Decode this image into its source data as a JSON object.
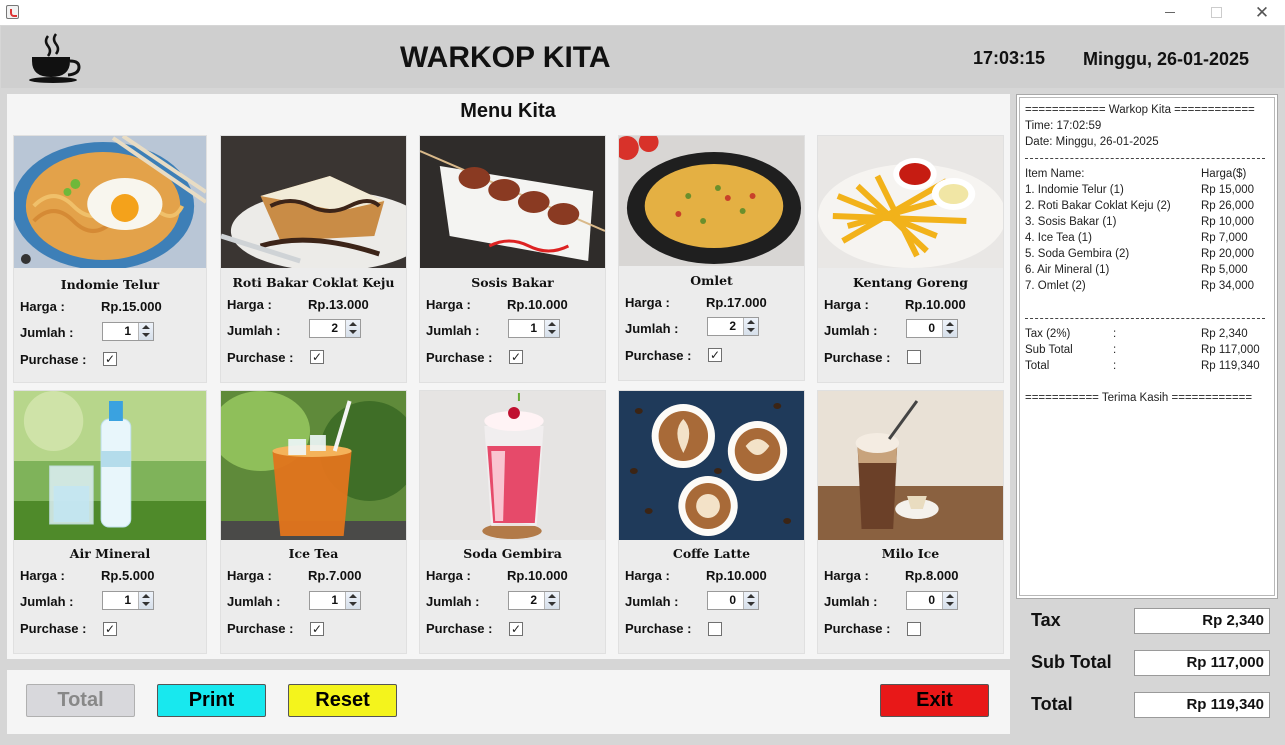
{
  "window": {
    "controls": [
      "minimize",
      "maximize",
      "close"
    ]
  },
  "header": {
    "title": "WARKOP KITA",
    "time": "17:03:15",
    "date": "Minggu, 26-01-2025",
    "logo_icon": "coffee-cup-icon"
  },
  "menu": {
    "title": "Menu Kita",
    "labels": {
      "price": "Harga :",
      "qty": "Jumlah :",
      "purchase": "Purchase :"
    },
    "items": [
      {
        "name": "Indomie Telur",
        "price": "Rp.15.000",
        "qty": "1",
        "purchased": true,
        "image": "noodle-egg-photo"
      },
      {
        "name": "Roti Bakar Coklat Keju",
        "price": "Rp.13.000",
        "qty": "2",
        "purchased": true,
        "image": "toast-photo"
      },
      {
        "name": "Sosis Bakar",
        "price": "Rp.10.000",
        "qty": "1",
        "purchased": true,
        "image": "sausage-photo"
      },
      {
        "name": "Omlet",
        "price": "Rp.17.000",
        "qty": "2",
        "purchased": true,
        "image": "omelette-photo"
      },
      {
        "name": "Kentang Goreng",
        "price": "Rp.10.000",
        "qty": "0",
        "purchased": false,
        "image": "fries-photo"
      },
      {
        "name": "Air Mineral",
        "price": "Rp.5.000",
        "qty": "1",
        "purchased": true,
        "image": "water-photo"
      },
      {
        "name": "Ice Tea",
        "price": "Rp.7.000",
        "qty": "1",
        "purchased": true,
        "image": "ice-tea-photo"
      },
      {
        "name": "Soda Gembira",
        "price": "Rp.10.000",
        "qty": "2",
        "purchased": true,
        "image": "soda-photo"
      },
      {
        "name": "Coffe Latte",
        "price": "Rp.10.000",
        "qty": "0",
        "purchased": false,
        "image": "latte-photo"
      },
      {
        "name": "Milo Ice",
        "price": "Rp.8.000",
        "qty": "0",
        "purchased": false,
        "image": "milo-photo"
      }
    ]
  },
  "receipt": {
    "header": "============ Warkop Kita ============",
    "time": "Time: 17:02:59",
    "date": "Date: Minggu, 26-01-2025",
    "col_item": "Item Name:",
    "col_price": "Harga($)",
    "lines": [
      {
        "item": "1. Indomie Telur (1)",
        "price": "Rp 15,000"
      },
      {
        "item": "2. Roti Bakar Coklat Keju (2)",
        "price": "Rp 26,000"
      },
      {
        "item": "3. Sosis Bakar (1)",
        "price": "Rp 10,000"
      },
      {
        "item": "4. Ice Tea (1)",
        "price": "Rp 7,000"
      },
      {
        "item": "5. Soda Gembira (2)",
        "price": "Rp 20,000"
      },
      {
        "item": "6. Air Mineral (1)",
        "price": "Rp 5,000"
      },
      {
        "item": "7. Omlet (2)",
        "price": "Rp 34,000"
      }
    ],
    "summary": [
      {
        "label": "Tax (2%)",
        "colon": ":",
        "value": "Rp 2,340"
      },
      {
        "label": "Sub Total",
        "colon": ":",
        "value": "Rp 117,000"
      },
      {
        "label": "Total",
        "colon": ":",
        "value": "Rp 119,340"
      }
    ],
    "footer": "=========== Terima Kasih ============"
  },
  "totals": {
    "tax_label": "Tax",
    "tax_value": "Rp 2,340",
    "subtotal_label": "Sub Total",
    "subtotal_value": "Rp 117,000",
    "total_label": "Total",
    "total_value": "Rp 119,340"
  },
  "buttons": {
    "total": "Total",
    "print": "Print",
    "reset": "Reset",
    "exit": "Exit"
  }
}
